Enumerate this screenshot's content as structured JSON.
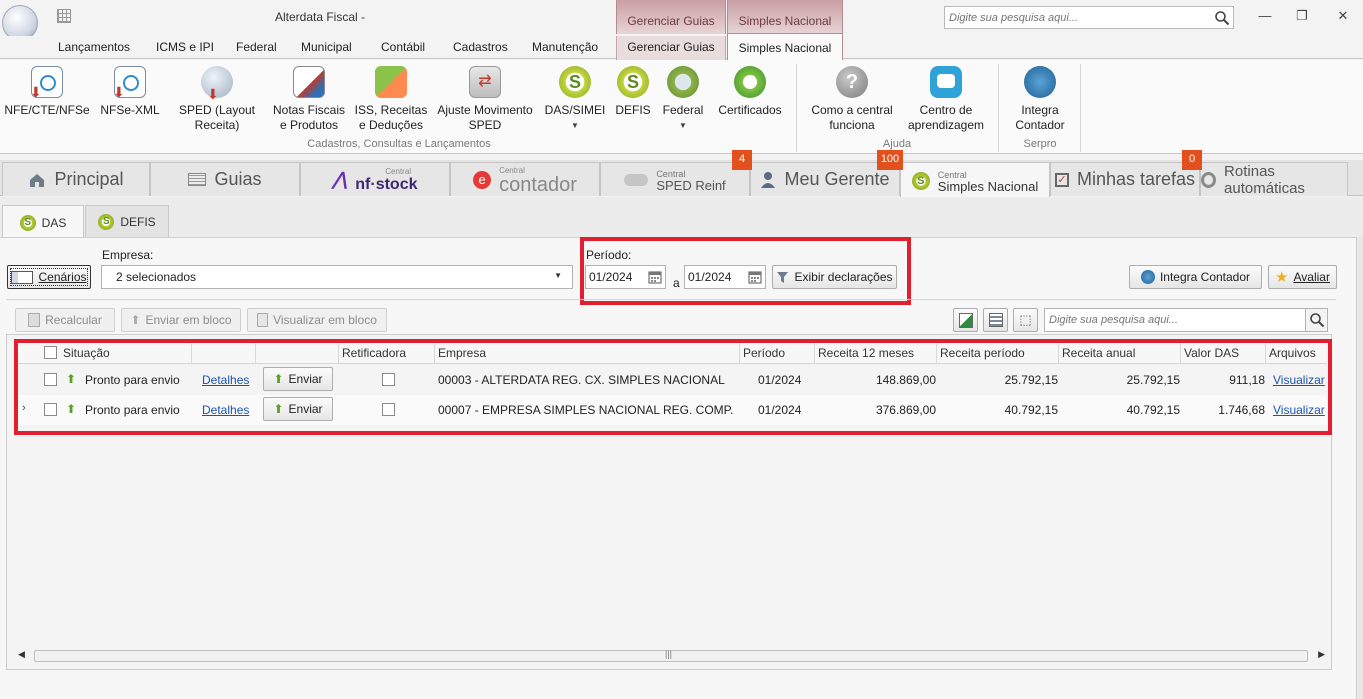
{
  "window": {
    "title": "Alterdata Fiscal -",
    "context_tabs": [
      "Gerenciar Guias",
      "Simples Nacional"
    ],
    "search_placeholder": "Digite sua pesquisa aqui..."
  },
  "menu": {
    "items": [
      "Lançamentos",
      "ICMS e IPI",
      "Federal",
      "Municipal",
      "Contábil",
      "Cadastros",
      "Manutenção",
      "Gerenciar Guias",
      "Simples Nacional"
    ]
  },
  "ribbon": {
    "buttons": [
      {
        "label": "NFE/CTE/NFSe",
        "icon": "nfe-icon"
      },
      {
        "label": "NFSe-XML",
        "icon": "nfse-xml-icon"
      },
      {
        "label": "SPED (Layout Receita)",
        "icon": "sped-icon"
      },
      {
        "label": "Notas Fiscais e Produtos",
        "icon": "notas-fiscais-icon"
      },
      {
        "label": "ISS, Receitas e Deduções",
        "icon": "iss-icon"
      },
      {
        "label": "Ajuste Movimento SPED",
        "icon": "ajuste-icon"
      },
      {
        "label": "DAS/SIMEI",
        "icon": "das-simei-icon"
      },
      {
        "label": "DEFIS",
        "icon": "defis-icon"
      },
      {
        "label": "Federal",
        "icon": "federal-icon"
      },
      {
        "label": "Certificados",
        "icon": "certificados-icon"
      },
      {
        "label": "Como a central funciona",
        "icon": "help-icon"
      },
      {
        "label": "Centro de aprendizagem",
        "icon": "learning-icon"
      },
      {
        "label": "Integra Contador",
        "icon": "integra-icon"
      }
    ],
    "groups": [
      "Cadastros, Consultas e Lançamentos",
      "Ajuda",
      "Serpro"
    ]
  },
  "main_tabs": [
    {
      "label": "Principal"
    },
    {
      "label": "Guias"
    },
    {
      "label": "nf·stock",
      "sup": "Central"
    },
    {
      "label": "contador",
      "sup": "Central"
    },
    {
      "label": "SPED Reinf",
      "sup": "Central",
      "badge": "4"
    },
    {
      "label": "Meu Gerente",
      "badge": "100"
    },
    {
      "label": "Simples Nacional",
      "sup": "Central"
    },
    {
      "label": "Minhas tarefas",
      "badge": "0"
    },
    {
      "label": "Rotinas automáticas"
    }
  ],
  "sub_tabs": [
    "DAS",
    "DEFIS"
  ],
  "filters": {
    "cenarios_label": "Cenários",
    "empresa_label": "Empresa:",
    "empresa_value": "2 selecionados",
    "periodo_label": "Período:",
    "periodo_de": "01/2024",
    "periodo_sep": "a",
    "periodo_ate": "01/2024",
    "exibir_label": "Exibir declarações",
    "integra_label": "Integra Contador",
    "avaliar_label": "Avaliar"
  },
  "toolbar": {
    "recalcular": "Recalcular",
    "enviar_bloco": "Enviar em bloco",
    "visualizar_bloco": "Visualizar em bloco",
    "search_placeholder": "Digite sua pesquisa aqui..."
  },
  "table": {
    "columns": [
      "Situação",
      "Retificadora",
      "Empresa",
      "Período",
      "Receita 12 meses",
      "Receita período",
      "Receita anual",
      "Valor DAS",
      "Arquivos"
    ],
    "rows": [
      {
        "situacao": "Pronto para envio",
        "detalhes": "Detalhes",
        "enviar": "Enviar",
        "empresa": "00003 - ALTERDATA REG. CX.  SIMPLES NACIONAL",
        "periodo": "01/2024",
        "receita12": "148.869,00",
        "receita_periodo": "25.792,15",
        "receita_anual": "25.792,15",
        "valor_das": "911,18",
        "arquivos": "Visualizar"
      },
      {
        "situacao": "Pronto para envio",
        "detalhes": "Detalhes",
        "enviar": "Enviar",
        "empresa": "00007 - EMPRESA SIMPLES NACIONAL REG. COMP.",
        "periodo": "01/2024",
        "receita12": "376.869,00",
        "receita_periodo": "40.792,15",
        "receita_anual": "40.792,15",
        "valor_das": "1.746,68",
        "arquivos": "Visualizar"
      }
    ]
  },
  "colors": {
    "highlight": "#e0202e",
    "badge": "#e2511d",
    "link": "#1c52b0",
    "context_tab": "#c99fa3"
  }
}
